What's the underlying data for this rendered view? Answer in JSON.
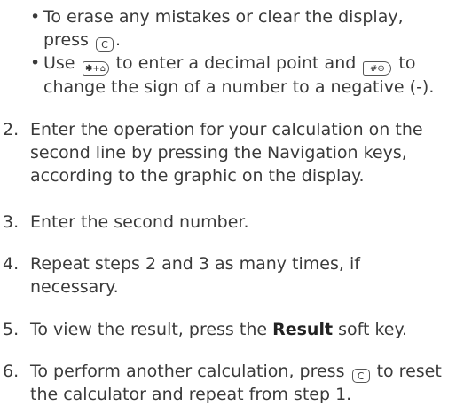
{
  "bullets": {
    "erase_pre": "To erase any mistakes or clear the display, press ",
    "erase_post": ".",
    "use_pre": "Use ",
    "use_mid": " to enter a decimal point and ",
    "use_post": " to change the sign of a number to a negative (-)."
  },
  "keys": {
    "clear": "C",
    "star": "✱+⌂",
    "hash": "#⊖"
  },
  "steps": [
    {
      "num": "2.",
      "text": "Enter the operation for your calculation on the second line by pressing the Navigation keys, according to the graphic on the display."
    },
    {
      "num": "3.",
      "text": "Enter the second number."
    },
    {
      "num": "4.",
      "text": "Repeat steps 2 and 3 as many times, if necessary."
    },
    {
      "num": "5.",
      "pre": "To view the result, press the ",
      "bold": "Result",
      "post": " soft key."
    },
    {
      "num": "6.",
      "pre": "To perform another calculation, press ",
      "post": " to reset the calculator and repeat from step 1."
    }
  ]
}
